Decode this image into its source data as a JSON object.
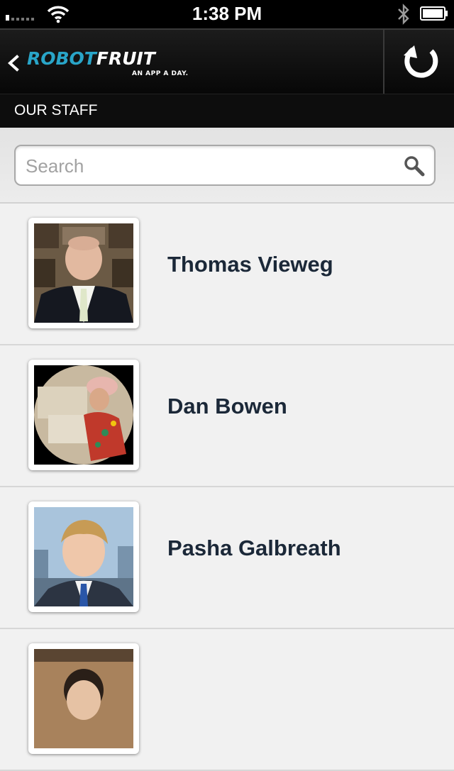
{
  "status_bar": {
    "time": "1:38 PM",
    "signal_icon": "signal-bars-icon",
    "wifi_icon": "wifi-icon",
    "bluetooth_icon": "bluetooth-icon",
    "battery_icon": "battery-icon"
  },
  "nav_bar": {
    "back_icon": "chevron-left-icon",
    "logo_part1": "ROBOT",
    "logo_part2": "FRUIT",
    "logo_tagline": "AN APP A DAY.",
    "refresh_icon": "refresh-icon",
    "accent_color": "#29a5c8"
  },
  "section": {
    "title": "OUR STAFF"
  },
  "search": {
    "placeholder": "Search",
    "value": "",
    "icon": "search-icon"
  },
  "staff": [
    {
      "name": "Thomas Vieweg"
    },
    {
      "name": "Dan Bowen"
    },
    {
      "name": "Pasha Galbreath"
    },
    {
      "name": ""
    }
  ],
  "colors": {
    "name_text": "#1b2838",
    "list_bg": "#f1f1f1"
  }
}
